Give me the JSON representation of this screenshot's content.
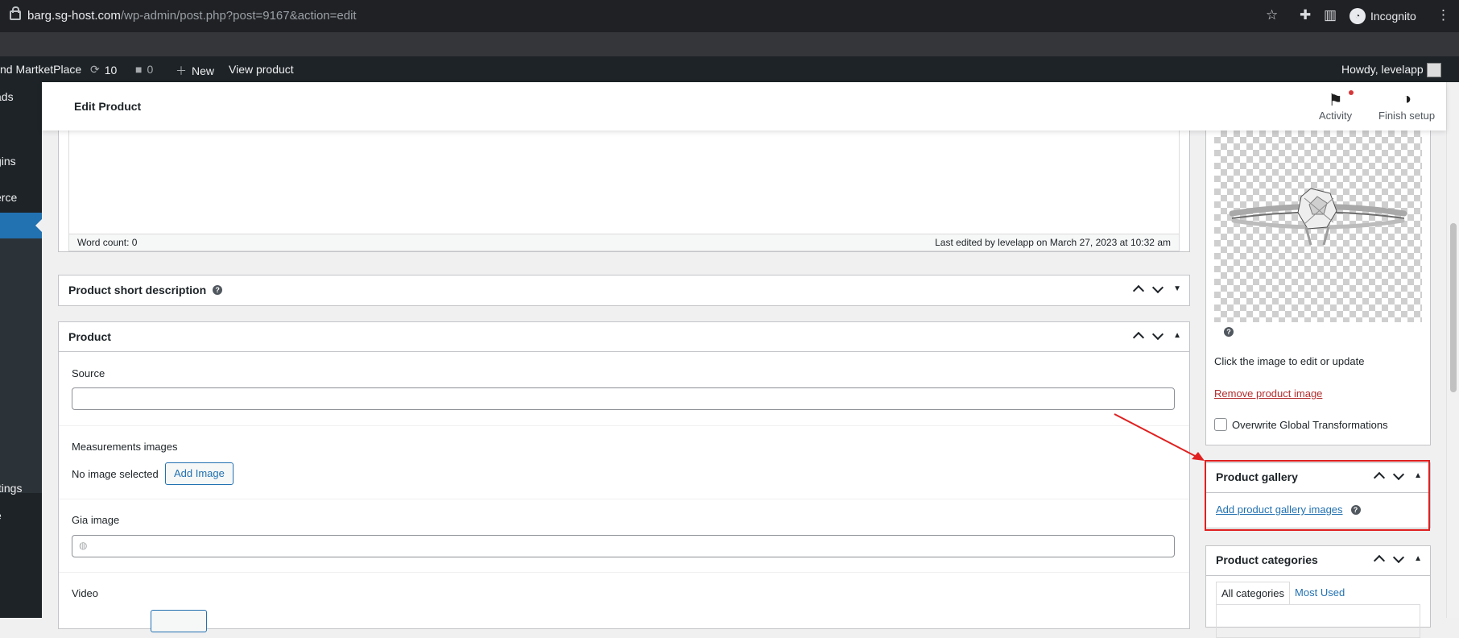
{
  "browser": {
    "url_host": "barg.sg-host.com",
    "url_path": "/wp-admin/post.php?post=9167&action=edit",
    "profile_label": "Incognito"
  },
  "admin_bar": {
    "site_name": "nd MartketPlace",
    "updates_count": "10",
    "comments_count": "0",
    "new_label": "New",
    "view_product_label": "View product",
    "howdy_label": "Howdy, levelapp"
  },
  "admin_menu": {
    "items": [
      {
        "label": "ads"
      },
      {
        "label": "gins"
      },
      {
        "label": "erce"
      },
      {
        "label": "ttings"
      },
      {
        "label": "e"
      }
    ]
  },
  "header": {
    "title": "Edit Product",
    "activity_label": "Activity",
    "finish_setup_label": "Finish setup"
  },
  "editor": {
    "word_count": "Word count: 0",
    "last_edited": "Last edited by levelapp on March 27, 2023 at 10:32 am"
  },
  "short_description_box": {
    "title": "Product short description"
  },
  "product_box": {
    "title": "Product",
    "source_label": "Source",
    "source_value": "",
    "measurements_label": "Measurements images",
    "no_image_text": "No image selected",
    "add_image_label": "Add Image",
    "gia_label": "Gia image",
    "gia_value": "",
    "video_label": "Video"
  },
  "product_image_box": {
    "help_text": "Click the image to edit or update",
    "remove_label": "Remove product image",
    "overwrite_label": "Overwrite Global Transformations"
  },
  "gallery_box": {
    "title": "Product gallery",
    "add_label": "Add product gallery images"
  },
  "categories_box": {
    "title": "Product categories",
    "tab_all": "All categories",
    "tab_most_used": "Most Used"
  },
  "colors": {
    "accent": "#2271b1",
    "danger": "#b32d2e",
    "annotation": "#e02020"
  }
}
